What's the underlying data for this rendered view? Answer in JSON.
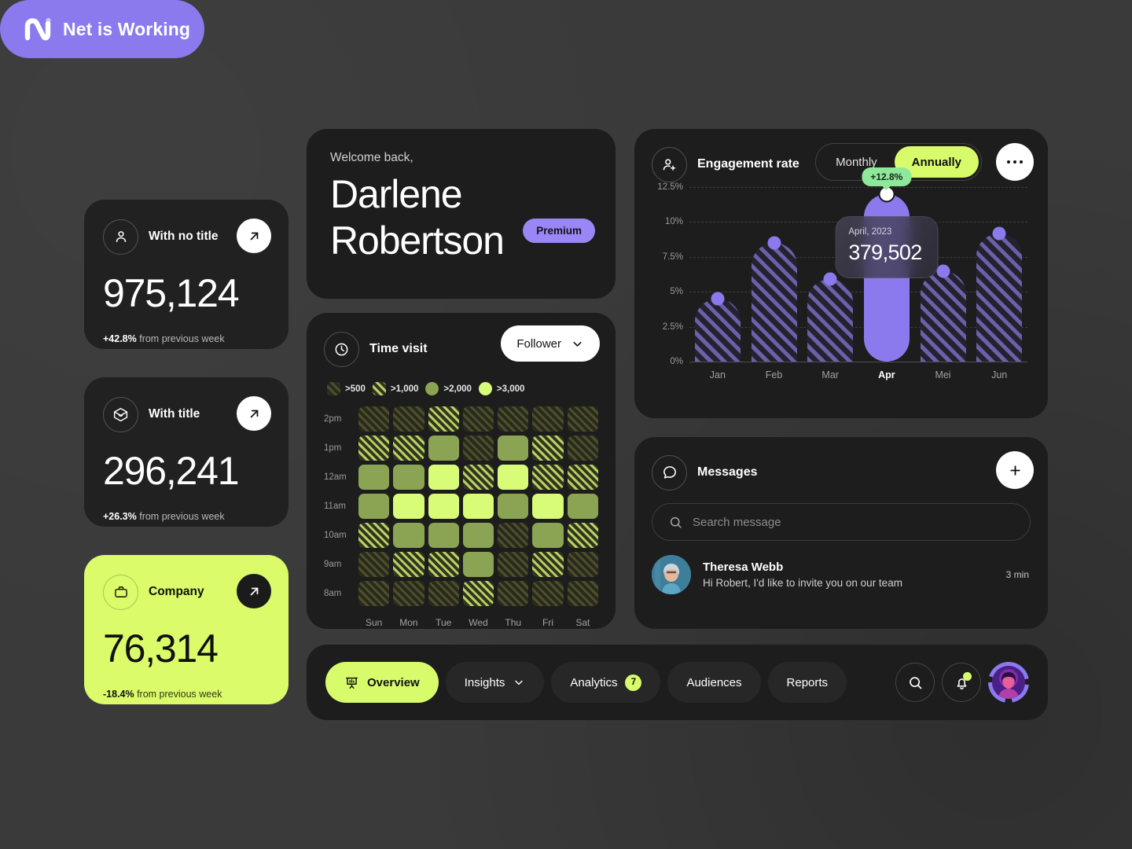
{
  "brand": {
    "name": "Net is Working",
    "logo_icon": "net-logo-icon",
    "color": "#8b7aed"
  },
  "accent": {
    "lime": "#d8fb6b",
    "purple": "#8b7aed",
    "green": "#8fe89a"
  },
  "stats": [
    {
      "icon": "person-icon",
      "title": "With no title",
      "value": "975,124",
      "delta": "+42.8%",
      "delta_suffix": " from previous week",
      "arrow_icon": "arrow-up-right-icon"
    },
    {
      "icon": "box-3d-icon",
      "title": "With title",
      "value": "296,241",
      "delta": "+26.3%",
      "delta_suffix": " from previous week",
      "arrow_icon": "arrow-up-right-icon"
    },
    {
      "icon": "briefcase-icon",
      "title": "Company",
      "value": "76,314",
      "delta": "-18.4%",
      "delta_suffix": " from previous week",
      "arrow_icon": "arrow-up-right-icon"
    }
  ],
  "welcome": {
    "greeting": "Welcome back,",
    "first_name": "Darlene",
    "last_name": "Robertson",
    "badge": "Premium"
  },
  "time_visit": {
    "icon": "clock-icon",
    "title": "Time visit",
    "filter_label": "Follower",
    "filter_icon": "chevron-down-icon",
    "legend": [
      {
        "label": ">500",
        "level": 1
      },
      {
        "label": ">1,000",
        "level": 2
      },
      {
        "label": ">2,000",
        "level": 3
      },
      {
        "label": ">3,000",
        "level": 4
      }
    ],
    "chart_data": {
      "type": "heatmap",
      "title": "Time visit",
      "xlabel": "",
      "ylabel": "",
      "x": [
        "Sun",
        "Mon",
        "Tue",
        "Wed",
        "Thu",
        "Fri",
        "Sat"
      ],
      "y": [
        "2pm",
        "1pm",
        "12am",
        "11am",
        "10am",
        "9am",
        "8am"
      ],
      "legend": [
        ">500",
        ">1,000",
        ">2,000",
        ">3,000"
      ],
      "values": [
        [
          1,
          1,
          2,
          1,
          1,
          1,
          1
        ],
        [
          2,
          2,
          3,
          1,
          3,
          2,
          1
        ],
        [
          3,
          3,
          4,
          2,
          4,
          2,
          2
        ],
        [
          3,
          4,
          4,
          4,
          3,
          4,
          3
        ],
        [
          2,
          3,
          3,
          3,
          1,
          3,
          2
        ],
        [
          1,
          2,
          2,
          3,
          1,
          2,
          1
        ],
        [
          1,
          1,
          1,
          2,
          1,
          1,
          1
        ]
      ]
    }
  },
  "engagement": {
    "icon": "add-person-icon",
    "title": "Engagement rate",
    "periods": [
      {
        "label": "Monthly",
        "active": false
      },
      {
        "label": "Annually",
        "active": true
      }
    ],
    "more_icon": "more-horizontal-icon",
    "delta_badge": "+12.8%",
    "tooltip": {
      "date": "April, 2023",
      "value": "379,502"
    },
    "chart_data": {
      "type": "bar",
      "title": "Engagement rate",
      "categories": [
        "Jan",
        "Feb",
        "Mar",
        "Apr",
        "Mei",
        "Jun"
      ],
      "values": [
        4.5,
        8.5,
        5.9,
        12.0,
        6.5,
        9.2
      ],
      "highlight_index": 3,
      "xlabel": "",
      "ylabel": "",
      "ylim": [
        0,
        12.5
      ],
      "yticks": [
        "0%",
        "2.5%",
        "5%",
        "7.5%",
        "10%",
        "12.5%"
      ],
      "ytick_values": [
        0,
        2.5,
        5,
        7.5,
        10,
        12.5
      ],
      "grid": true,
      "legend": []
    }
  },
  "messages": {
    "icon": "chat-bubble-icon",
    "title": "Messages",
    "add_icon": "plus-icon",
    "search_placeholder": "Search message",
    "search_value": "",
    "search_icon": "search-icon",
    "items": [
      {
        "avatar": "avatar-theresa",
        "name": "Theresa Webb",
        "preview": "Hi Robert, I'd like to invite you on our team",
        "time": "3 min"
      }
    ]
  },
  "bottom_nav": {
    "tabs": [
      {
        "label": "Overview",
        "icon": "presentation-chart-icon",
        "active": true,
        "badge": null,
        "chevron": false
      },
      {
        "label": "Insights",
        "icon": null,
        "active": false,
        "badge": null,
        "chevron": true
      },
      {
        "label": "Analytics",
        "icon": null,
        "active": false,
        "badge": "7",
        "chevron": false
      },
      {
        "label": "Audiences",
        "icon": null,
        "active": false,
        "badge": null,
        "chevron": false
      },
      {
        "label": "Reports",
        "icon": null,
        "active": false,
        "badge": null,
        "chevron": false
      }
    ],
    "actions": [
      {
        "name": "search-icon"
      },
      {
        "name": "bell-icon"
      },
      {
        "name": "avatar"
      }
    ]
  }
}
